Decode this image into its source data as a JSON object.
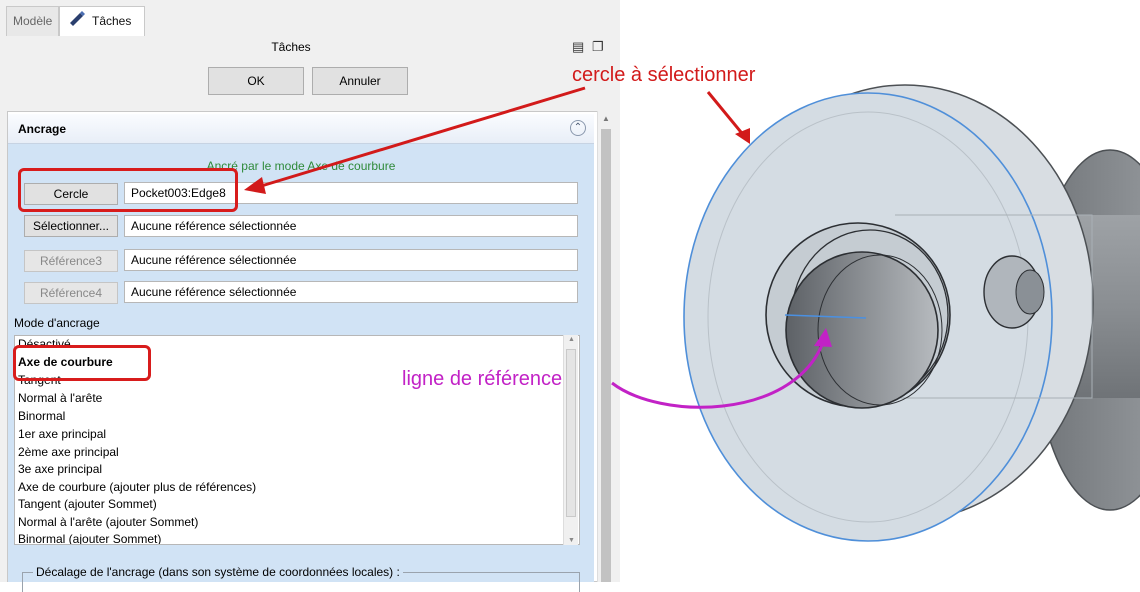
{
  "tabs": [
    {
      "label": "Modèle"
    },
    {
      "label": "Tâches"
    }
  ],
  "task_panel": {
    "title": "Tâches",
    "ok_label": "OK",
    "cancel_label": "Annuler"
  },
  "attachment": {
    "section_title": "Ancrage",
    "status": "Ancré par le mode Axe de courbure",
    "references": [
      {
        "button": "Cercle",
        "value": "Pocket003:Edge8",
        "enabled": true
      },
      {
        "button": "Sélectionner...",
        "value": "Aucune référence sélectionnée",
        "enabled": true
      },
      {
        "button": "Référence3",
        "value": "Aucune référence sélectionnée",
        "enabled": false
      },
      {
        "button": "Référence4",
        "value": "Aucune référence sélectionnée",
        "enabled": false
      }
    ],
    "mode_label": "Mode d'ancrage",
    "modes": [
      "Désactivé",
      "Axe de courbure",
      "Tangent",
      "Normal à l'arête",
      "Binormal",
      "1er axe principal",
      "2ème axe principal",
      "3e axe principal",
      "Axe de courbure (ajouter plus de références)",
      "Tangent (ajouter Sommet)",
      "Normal à l'arête (ajouter Sommet)",
      "Binormal (ajouter Sommet)"
    ],
    "selected_mode": "Axe de courbure",
    "offset_group_title": "Décalage de l'ancrage (dans son système de coordonnées locales) :"
  },
  "annotations": {
    "circle_to_select": "cercle à sélectionner",
    "reference_line": "ligne de référence"
  },
  "colors": {
    "annotation_red": "#d21a1a",
    "annotation_magenta": "#c222c6",
    "status_green": "#2f8a3a",
    "section_background": "#d1e3f5"
  },
  "icons": {
    "tasks_tab": "pencil-icon",
    "collapse": "chevron-up-double-icon",
    "float": "undock-icon",
    "dock": "dock-icon"
  }
}
